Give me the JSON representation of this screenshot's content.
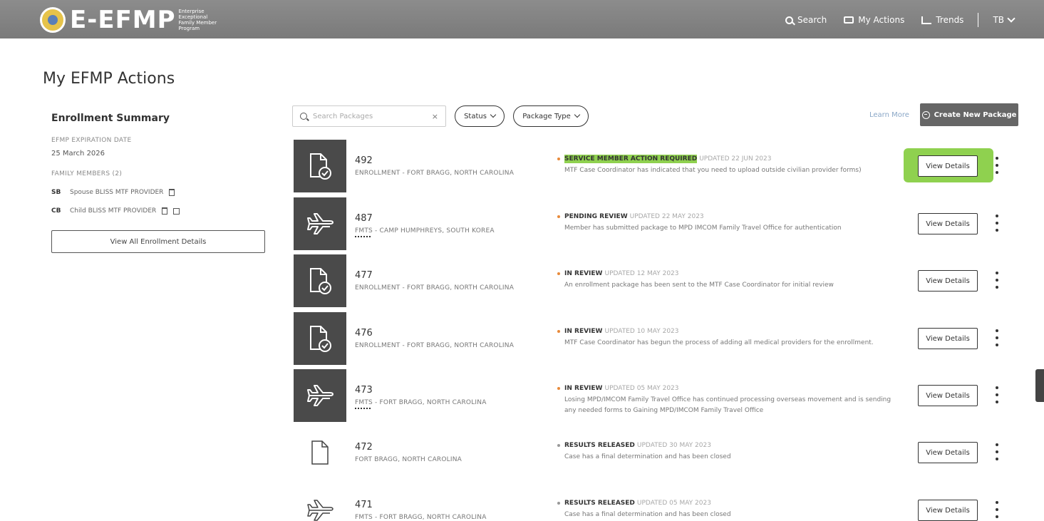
{
  "header": {
    "logo_text": "E-EFMP",
    "logo_subtitle": "Enterprise Exceptional Family Member Program",
    "nav": [
      {
        "label": "Search",
        "icon": "search-icon"
      },
      {
        "label": "My Actions",
        "icon": "folder-icon"
      },
      {
        "label": "Trends",
        "icon": "chart-icon"
      }
    ],
    "user_initials": "TB"
  },
  "page": {
    "title": "My EFMP Actions"
  },
  "sidebar": {
    "title": "Enrollment Summary",
    "expiration_label": "EFMP EXPIRATION DATE",
    "expiration_value": "25 March 2026",
    "family_label": "FAMILY MEMBERS (2)",
    "members": [
      {
        "initials": "SB",
        "name": "Spouse BLISS MTF PROVIDER"
      },
      {
        "initials": "CB",
        "name": "Child BLISS MTF PROVIDER"
      }
    ],
    "view_all_label": "View All Enrollment Details"
  },
  "filters": {
    "search_placeholder": "Search Packages",
    "clear_symbol": "×",
    "status_label": "Status",
    "package_type_label": "Package Type",
    "learn_more": "Learn More",
    "create_label": "Create New Package"
  },
  "packages": [
    {
      "id": "492",
      "location": "ENROLLMENT - FORT BRAGG, NORTH CAROLINA",
      "status": "SERVICE MEMBER ACTION REQUIRED",
      "updated": "UPDATED 22 JUN 2023",
      "desc": "MTF Case Coordinator has indicated that you need to upload outside civilian provider forms)",
      "icon": "document-check-icon",
      "view_label": "View Details"
    },
    {
      "id": "487",
      "location": "FMTS - CAMP HUMPHREYS, SOUTH KOREA",
      "status": "PENDING REVIEW",
      "updated": "UPDATED 22 MAY 2023",
      "desc": "Member has submitted package to MPD IMCOM Family Travel Office for authentication",
      "icon": "airplane-icon",
      "view_label": "View Details"
    },
    {
      "id": "477",
      "location": "ENROLLMENT - FORT BRAGG, NORTH CAROLINA",
      "status": "IN REVIEW",
      "updated": "UPDATED 12 MAY 2023",
      "desc": "An enrollment package has been sent to the MTF Case Coordinator for initial review",
      "icon": "document-check-icon",
      "view_label": "View Details"
    },
    {
      "id": "476",
      "location": "ENROLLMENT - FORT BRAGG, NORTH CAROLINA",
      "status": "IN REVIEW",
      "updated": "UPDATED 10 MAY 2023",
      "desc": "MTF Case Coordinator has begun the process of adding all medical providers for the enrollment.",
      "icon": "document-check-icon",
      "view_label": "View Details"
    },
    {
      "id": "473",
      "location": "FMTS - FORT BRAGG, NORTH CAROLINA",
      "status": "IN REVIEW",
      "updated": "UPDATED 05 MAY 2023",
      "desc": "Losing MPD/IMCOM Family Travel Office has continued processing overseas movement and is sending any needed forms to Gaining MPD/IMCOM Family Travel Office",
      "icon": "airplane-icon",
      "view_label": "View Details"
    },
    {
      "id": "472",
      "location": "FORT BRAGG, NORTH CAROLINA",
      "status": "RESULTS RELEASED",
      "updated": "UPDATED 30 MAY 2023",
      "desc": "Case has a final determination and has been closed",
      "icon": "document-icon",
      "view_label": "View Details"
    },
    {
      "id": "471",
      "location": "FMTS - FORT BRAGG, NORTH CAROLINA",
      "status": "RESULTS RELEASED",
      "updated": "UPDATED 05 MAY 2023",
      "desc": "Case has a final determination and has been closed",
      "icon": "airplane-icon",
      "view_label": "View Details"
    }
  ],
  "colors": {
    "header_bg": "#7f7f7f",
    "accent_orange": "#e88a3a",
    "highlight_green": "#8fd14f",
    "thumb_bg": "#4a4a4a"
  }
}
